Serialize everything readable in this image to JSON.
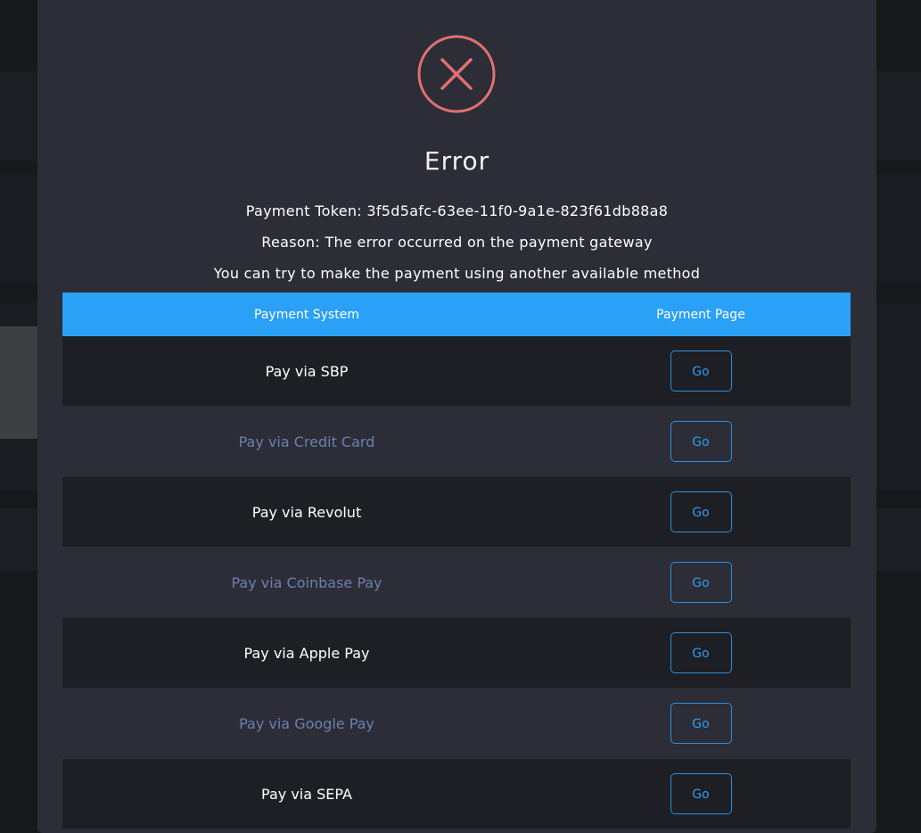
{
  "modal": {
    "title": "Error",
    "token_line": "Payment Token: 3f5d5afc-63ee-11f0-9a1e-823f61db88a8",
    "reason_line": "Reason: The error occurred on the payment gateway",
    "hint_line": "You can try to make the payment using another available method",
    "icon": "error-x-circle-icon",
    "colors": {
      "modal_bg": "#2c2d37",
      "icon": "#e07070",
      "header": "#2aa0f6",
      "button": "#2e9bf0",
      "row_alt_text": "#6d7fb0"
    }
  },
  "table": {
    "headers": [
      "Payment System",
      "Payment Page"
    ],
    "rows": [
      {
        "system": "Pay via SBP",
        "action": "Go"
      },
      {
        "system": "Pay via Credit Card",
        "action": "Go"
      },
      {
        "system": "Pay via Revolut",
        "action": "Go"
      },
      {
        "system": "Pay via Coinbase Pay",
        "action": "Go"
      },
      {
        "system": "Pay via Apple Pay",
        "action": "Go"
      },
      {
        "system": "Pay via Google Pay",
        "action": "Go"
      },
      {
        "system": "Pay via SEPA",
        "action": "Go"
      }
    ]
  }
}
